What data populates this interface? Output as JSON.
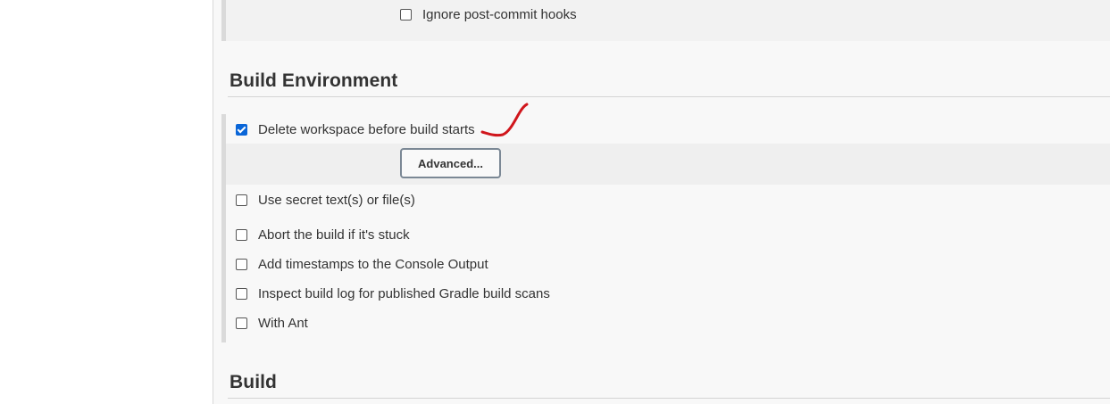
{
  "prev_section": {
    "options": [
      {
        "label": "Ignore post-commit hooks",
        "checked": false
      }
    ]
  },
  "build_environment": {
    "title": "Build Environment",
    "options": [
      {
        "label": "Delete workspace before build starts",
        "checked": true
      },
      {
        "label": "Use secret text(s) or file(s)",
        "checked": false
      },
      {
        "label": "Abort the build if it's stuck",
        "checked": false
      },
      {
        "label": "Add timestamps to the Console Output",
        "checked": false
      },
      {
        "label": "Inspect build log for published Gradle build scans",
        "checked": false
      },
      {
        "label": "With Ant",
        "checked": false
      }
    ],
    "advanced_label": "Advanced..."
  },
  "build": {
    "title": "Build"
  },
  "colors": {
    "checkbox_checked": "#0a66d8",
    "annotation_mark": "#d0161c"
  }
}
